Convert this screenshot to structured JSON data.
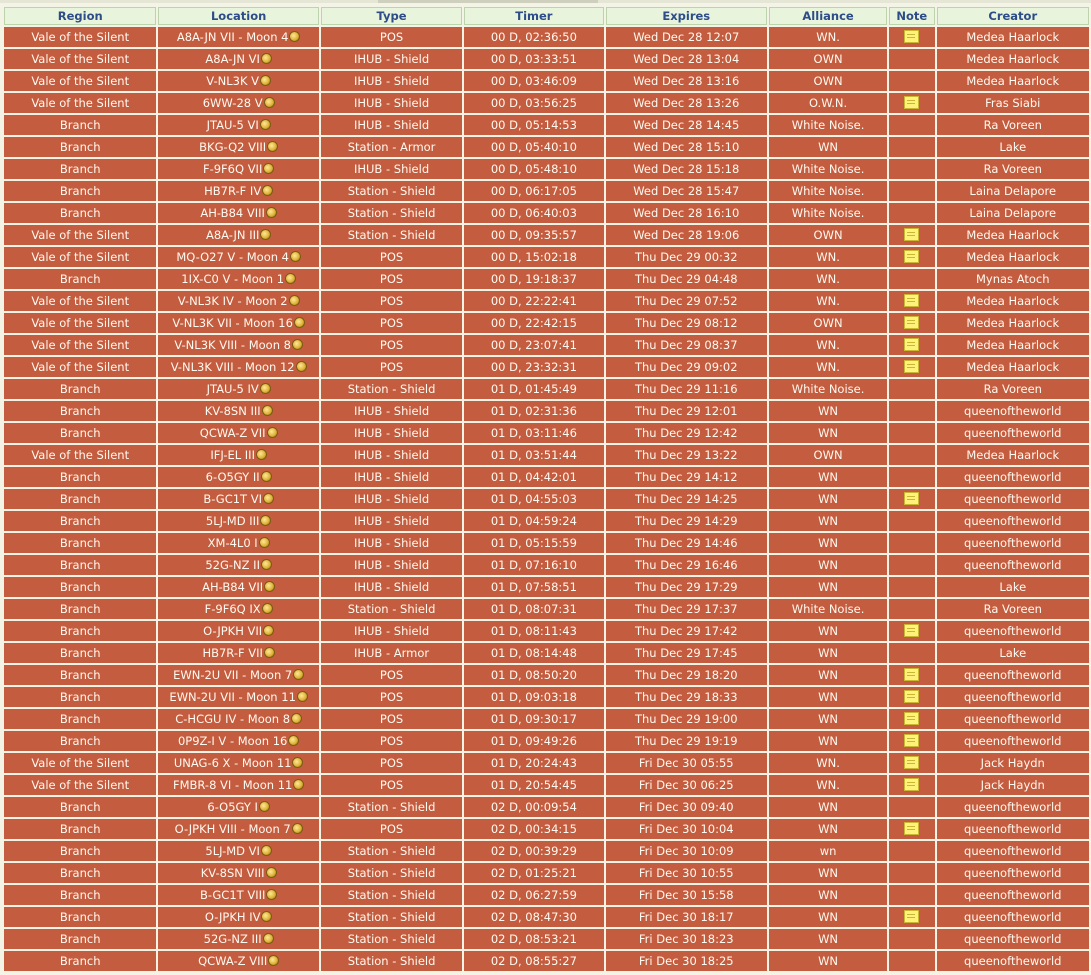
{
  "headers": [
    "Region",
    "Location",
    "Type",
    "Timer",
    "Expires",
    "Alliance",
    "Note",
    "Creator"
  ],
  "rows": [
    {
      "region": "Vale of the Silent",
      "location": "A8A-JN VII - Moon 4",
      "type": "POS",
      "timer": "00 D, 02:36:50",
      "expires": "Wed Dec 28 12:07",
      "alliance": "WN.",
      "note": true,
      "creator": "Medea Haarlock"
    },
    {
      "region": "Vale of the Silent",
      "location": "A8A-JN VI",
      "type": "IHUB - Shield",
      "timer": "00 D, 03:33:51",
      "expires": "Wed Dec 28 13:04",
      "alliance": "OWN",
      "note": false,
      "creator": "Medea Haarlock"
    },
    {
      "region": "Vale of the Silent",
      "location": "V-NL3K V",
      "type": "IHUB - Shield",
      "timer": "00 D, 03:46:09",
      "expires": "Wed Dec 28 13:16",
      "alliance": "OWN",
      "note": false,
      "creator": "Medea Haarlock"
    },
    {
      "region": "Vale of the Silent",
      "location": "6WW-28 V",
      "type": "IHUB - Shield",
      "timer": "00 D, 03:56:25",
      "expires": "Wed Dec 28 13:26",
      "alliance": "O.W.N.",
      "note": true,
      "creator": "Fras Siabi"
    },
    {
      "region": "Branch",
      "location": "JTAU-5 VI",
      "type": "IHUB - Shield",
      "timer": "00 D, 05:14:53",
      "expires": "Wed Dec 28 14:45",
      "alliance": "White Noise.",
      "note": false,
      "creator": "Ra Voreen"
    },
    {
      "region": "Branch",
      "location": "BKG-Q2 VIII",
      "type": "Station - Armor",
      "timer": "00 D, 05:40:10",
      "expires": "Wed Dec 28 15:10",
      "alliance": "WN",
      "note": false,
      "creator": "Lake"
    },
    {
      "region": "Branch",
      "location": "F-9F6Q VII",
      "type": "IHUB - Shield",
      "timer": "00 D, 05:48:10",
      "expires": "Wed Dec 28 15:18",
      "alliance": "White Noise.",
      "note": false,
      "creator": "Ra Voreen"
    },
    {
      "region": "Branch",
      "location": "HB7R-F IV",
      "type": "Station - Shield",
      "timer": "00 D, 06:17:05",
      "expires": "Wed Dec 28 15:47",
      "alliance": "White Noise.",
      "note": false,
      "creator": "Laina Delapore"
    },
    {
      "region": "Branch",
      "location": "AH-B84 VIII",
      "type": "Station - Shield",
      "timer": "00 D, 06:40:03",
      "expires": "Wed Dec 28 16:10",
      "alliance": "White Noise.",
      "note": false,
      "creator": "Laina Delapore"
    },
    {
      "region": "Vale of the Silent",
      "location": "A8A-JN III",
      "type": "Station - Shield",
      "timer": "00 D, 09:35:57",
      "expires": "Wed Dec 28 19:06",
      "alliance": "OWN",
      "note": true,
      "creator": "Medea Haarlock"
    },
    {
      "region": "Vale of the Silent",
      "location": "MQ-O27 V - Moon 4",
      "type": "POS",
      "timer": "00 D, 15:02:18",
      "expires": "Thu Dec 29 00:32",
      "alliance": "WN.",
      "note": true,
      "creator": "Medea Haarlock"
    },
    {
      "region": "Branch",
      "location": "1IX-C0 V - Moon 1",
      "type": "POS",
      "timer": "00 D, 19:18:37",
      "expires": "Thu Dec 29 04:48",
      "alliance": "WN.",
      "note": false,
      "creator": "Mynas Atoch"
    },
    {
      "region": "Vale of the Silent",
      "location": "V-NL3K IV - Moon 2",
      "type": "POS",
      "timer": "00 D, 22:22:41",
      "expires": "Thu Dec 29 07:52",
      "alliance": "WN.",
      "note": true,
      "creator": "Medea Haarlock"
    },
    {
      "region": "Vale of the Silent",
      "location": "V-NL3K VII - Moon 16",
      "type": "POS",
      "timer": "00 D, 22:42:15",
      "expires": "Thu Dec 29 08:12",
      "alliance": "OWN",
      "note": true,
      "creator": "Medea Haarlock"
    },
    {
      "region": "Vale of the Silent",
      "location": "V-NL3K VIII - Moon 8",
      "type": "POS",
      "timer": "00 D, 23:07:41",
      "expires": "Thu Dec 29 08:37",
      "alliance": "WN.",
      "note": true,
      "creator": "Medea Haarlock"
    },
    {
      "region": "Vale of the Silent",
      "location": "V-NL3K VIII - Moon 12",
      "type": "POS",
      "timer": "00 D, 23:32:31",
      "expires": "Thu Dec 29 09:02",
      "alliance": "WN.",
      "note": true,
      "creator": "Medea Haarlock"
    },
    {
      "region": "Branch",
      "location": "JTAU-5 IV",
      "type": "Station - Shield",
      "timer": "01 D, 01:45:49",
      "expires": "Thu Dec 29 11:16",
      "alliance": "White Noise.",
      "note": false,
      "creator": "Ra Voreen"
    },
    {
      "region": "Branch",
      "location": "KV-8SN III",
      "type": "IHUB - Shield",
      "timer": "01 D, 02:31:36",
      "expires": "Thu Dec 29 12:01",
      "alliance": "WN",
      "note": false,
      "creator": "queenoftheworld"
    },
    {
      "region": "Branch",
      "location": "QCWA-Z VII",
      "type": "IHUB - Shield",
      "timer": "01 D, 03:11:46",
      "expires": "Thu Dec 29 12:42",
      "alliance": "WN",
      "note": false,
      "creator": "queenoftheworld"
    },
    {
      "region": "Vale of the Silent",
      "location": "IFJ-EL III",
      "type": "IHUB - Shield",
      "timer": "01 D, 03:51:44",
      "expires": "Thu Dec 29 13:22",
      "alliance": "OWN",
      "note": false,
      "creator": "Medea Haarlock"
    },
    {
      "region": "Branch",
      "location": "6-O5GY II",
      "type": "IHUB - Shield",
      "timer": "01 D, 04:42:01",
      "expires": "Thu Dec 29 14:12",
      "alliance": "WN",
      "note": false,
      "creator": "queenoftheworld"
    },
    {
      "region": "Branch",
      "location": "B-GC1T VI",
      "type": "IHUB - Shield",
      "timer": "01 D, 04:55:03",
      "expires": "Thu Dec 29 14:25",
      "alliance": "WN",
      "note": true,
      "creator": "queenoftheworld"
    },
    {
      "region": "Branch",
      "location": "5LJ-MD III",
      "type": "IHUB - Shield",
      "timer": "01 D, 04:59:24",
      "expires": "Thu Dec 29 14:29",
      "alliance": "WN",
      "note": false,
      "creator": "queenoftheworld"
    },
    {
      "region": "Branch",
      "location": "XM-4L0 I",
      "type": "IHUB - Shield",
      "timer": "01 D, 05:15:59",
      "expires": "Thu Dec 29 14:46",
      "alliance": "WN",
      "note": false,
      "creator": "queenoftheworld"
    },
    {
      "region": "Branch",
      "location": "52G-NZ II",
      "type": "IHUB - Shield",
      "timer": "01 D, 07:16:10",
      "expires": "Thu Dec 29 16:46",
      "alliance": "WN",
      "note": false,
      "creator": "queenoftheworld"
    },
    {
      "region": "Branch",
      "location": "AH-B84 VII",
      "type": "IHUB - Shield",
      "timer": "01 D, 07:58:51",
      "expires": "Thu Dec 29 17:29",
      "alliance": "WN",
      "note": false,
      "creator": "Lake"
    },
    {
      "region": "Branch",
      "location": "F-9F6Q IX",
      "type": "Station - Shield",
      "timer": "01 D, 08:07:31",
      "expires": "Thu Dec 29 17:37",
      "alliance": "White Noise.",
      "note": false,
      "creator": "Ra Voreen"
    },
    {
      "region": "Branch",
      "location": "O-JPKH VII",
      "type": "IHUB - Shield",
      "timer": "01 D, 08:11:43",
      "expires": "Thu Dec 29 17:42",
      "alliance": "WN",
      "note": true,
      "creator": "queenoftheworld"
    },
    {
      "region": "Branch",
      "location": "HB7R-F VII",
      "type": "IHUB - Armor",
      "timer": "01 D, 08:14:48",
      "expires": "Thu Dec 29 17:45",
      "alliance": "WN",
      "note": false,
      "creator": "Lake"
    },
    {
      "region": "Branch",
      "location": "EWN-2U VII - Moon 7",
      "type": "POS",
      "timer": "01 D, 08:50:20",
      "expires": "Thu Dec 29 18:20",
      "alliance": "WN",
      "note": true,
      "creator": "queenoftheworld"
    },
    {
      "region": "Branch",
      "location": "EWN-2U VII - Moon 11",
      "type": "POS",
      "timer": "01 D, 09:03:18",
      "expires": "Thu Dec 29 18:33",
      "alliance": "WN",
      "note": true,
      "creator": "queenoftheworld"
    },
    {
      "region": "Branch",
      "location": "C-HCGU IV - Moon 8",
      "type": "POS",
      "timer": "01 D, 09:30:17",
      "expires": "Thu Dec 29 19:00",
      "alliance": "WN",
      "note": true,
      "creator": "queenoftheworld"
    },
    {
      "region": "Branch",
      "location": "0P9Z-I V - Moon 16",
      "type": "POS",
      "timer": "01 D, 09:49:26",
      "expires": "Thu Dec 29 19:19",
      "alliance": "WN",
      "note": true,
      "creator": "queenoftheworld"
    },
    {
      "region": "Vale of the Silent",
      "location": "UNAG-6 X - Moon 11",
      "type": "POS",
      "timer": "01 D, 20:24:43",
      "expires": "Fri Dec 30 05:55",
      "alliance": "WN.",
      "note": true,
      "creator": "Jack Haydn"
    },
    {
      "region": "Vale of the Silent",
      "location": "FMBR-8 VI - Moon 11",
      "type": "POS",
      "timer": "01 D, 20:54:45",
      "expires": "Fri Dec 30 06:25",
      "alliance": "WN.",
      "note": true,
      "creator": "Jack Haydn"
    },
    {
      "region": "Branch",
      "location": "6-O5GY I",
      "type": "Station - Shield",
      "timer": "02 D, 00:09:54",
      "expires": "Fri Dec 30 09:40",
      "alliance": "WN",
      "note": false,
      "creator": "queenoftheworld"
    },
    {
      "region": "Branch",
      "location": "O-JPKH VIII - Moon 7",
      "type": "POS",
      "timer": "02 D, 00:34:15",
      "expires": "Fri Dec 30 10:04",
      "alliance": "WN",
      "note": true,
      "creator": "queenoftheworld"
    },
    {
      "region": "Branch",
      "location": "5LJ-MD VI",
      "type": "Station - Shield",
      "timer": "02 D, 00:39:29",
      "expires": "Fri Dec 30 10:09",
      "alliance": "wn",
      "note": false,
      "creator": "queenoftheworld"
    },
    {
      "region": "Branch",
      "location": "KV-8SN VIII",
      "type": "Station - Shield",
      "timer": "02 D, 01:25:21",
      "expires": "Fri Dec 30 10:55",
      "alliance": "WN",
      "note": false,
      "creator": "queenoftheworld"
    },
    {
      "region": "Branch",
      "location": "B-GC1T VIII",
      "type": "Station - Shield",
      "timer": "02 D, 06:27:59",
      "expires": "Fri Dec 30 15:58",
      "alliance": "WN",
      "note": false,
      "creator": "queenoftheworld"
    },
    {
      "region": "Branch",
      "location": "O-JPKH IV",
      "type": "Station - Shield",
      "timer": "02 D, 08:47:30",
      "expires": "Fri Dec 30 18:17",
      "alliance": "WN",
      "note": true,
      "creator": "queenoftheworld"
    },
    {
      "region": "Branch",
      "location": "52G-NZ III",
      "type": "Station - Shield",
      "timer": "02 D, 08:53:21",
      "expires": "Fri Dec 30 18:23",
      "alliance": "WN",
      "note": false,
      "creator": "queenoftheworld"
    },
    {
      "region": "Branch",
      "location": "QCWA-Z VIII",
      "type": "Station - Shield",
      "timer": "02 D, 08:55:27",
      "expires": "Fri Dec 30 18:25",
      "alliance": "WN",
      "note": false,
      "creator": "queenoftheworld"
    }
  ],
  "icons": {
    "location": "moon-icon",
    "note": "note-icon"
  },
  "colors": {
    "row_bg": "#c45c3f",
    "header_bg": "#e8f5dc",
    "header_text": "#2d4c88"
  }
}
